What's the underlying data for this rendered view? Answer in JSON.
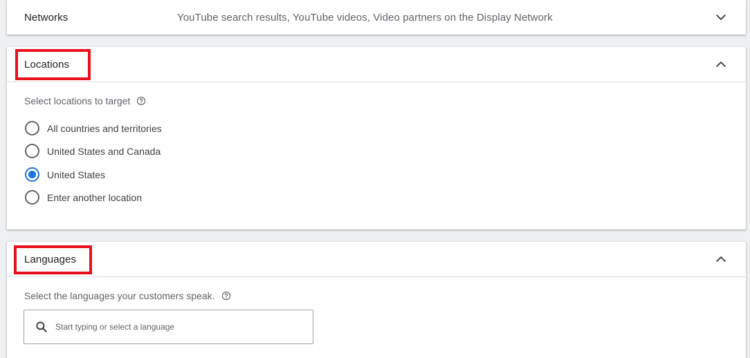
{
  "networks": {
    "title": "Networks",
    "summary": "YouTube search results, YouTube videos, Video partners on the Display Network",
    "toggle_icon": "chevron-down-icon"
  },
  "locations": {
    "title": "Locations",
    "toggle_icon": "chevron-up-icon",
    "prompt": "Select locations to target",
    "options": [
      {
        "label": "All countries and territories",
        "selected": false
      },
      {
        "label": "United States and Canada",
        "selected": false
      },
      {
        "label": "United States",
        "selected": true
      },
      {
        "label": "Enter another location",
        "selected": false
      }
    ]
  },
  "languages": {
    "title": "Languages",
    "toggle_icon": "chevron-up-icon",
    "prompt": "Select the languages your customers speak.",
    "search_placeholder": "Start typing or select a language"
  },
  "colors": {
    "highlight": "#e8111b",
    "radio_selected": "#1a73e8",
    "background": "#eef0f2"
  }
}
